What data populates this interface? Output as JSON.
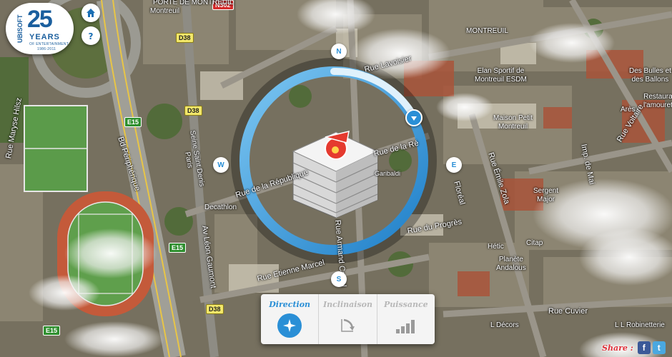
{
  "branding": {
    "logo_brand": "UBISOFT",
    "logo_number": "25",
    "logo_word": "YEARS",
    "logo_tagline": "OF ENTERTAINMENT",
    "logo_years": "1986-2011"
  },
  "nav": {
    "home_icon": "home-icon",
    "help_icon": "question-mark-icon"
  },
  "compass": {
    "north": "N",
    "east": "E",
    "south": "S",
    "west": "W",
    "accent": "#2a8fd6",
    "direction_handle_icon": "direction-handle-icon"
  },
  "map_labels": {
    "streets": [
      "PORTE DE MONTREUIL",
      "Bd Périphérique",
      "Rue Maryse Hilsz",
      "Seine Saint Denis\nParis",
      "Av Léon Gaumont",
      "Rue Armand Carrel",
      "Rue de la République",
      "Rue de la Ré",
      "Rue Etienne Marcel",
      "Rue du Progrès",
      "Rue Émile Zola",
      "Rue Lavoisier",
      "Rue Voltaire",
      "Rue Cuvier",
      "Imp. de Mai",
      "Floréal",
      "Decathlon",
      "Garibaldi"
    ],
    "pois": [
      "Elan Sportif de\nMontreuil ESDM",
      "Maison Petit\nMontreuil",
      "Des Bulles et\ndes Ballons",
      "Restaura\nl'amouret",
      "Arès",
      "Sergent\nMajor",
      "Hétic",
      "Planète\nAndalous",
      "Citap",
      "L Décors",
      "L L Robinetterie",
      "MONTREUIL",
      "Montreuil"
    ],
    "road_badges": [
      "N302",
      "D38",
      "D38",
      "D38",
      "E15",
      "E15",
      "E15"
    ]
  },
  "controls": {
    "tabs": [
      {
        "label": "Direction",
        "icon": "compass-rose-icon",
        "active": true
      },
      {
        "label": "Inclinaison",
        "icon": "tilt-arrow-icon",
        "active": false
      },
      {
        "label": "Puissance",
        "icon": "power-bars-icon",
        "active": false
      }
    ]
  },
  "share": {
    "label": "Share :",
    "facebook": "f",
    "twitter": "t"
  },
  "colors": {
    "accent_blue": "#2a8fd6",
    "share_red": "#e0303a",
    "facebook": "#3b5998",
    "twitter": "#4aa8e0"
  }
}
